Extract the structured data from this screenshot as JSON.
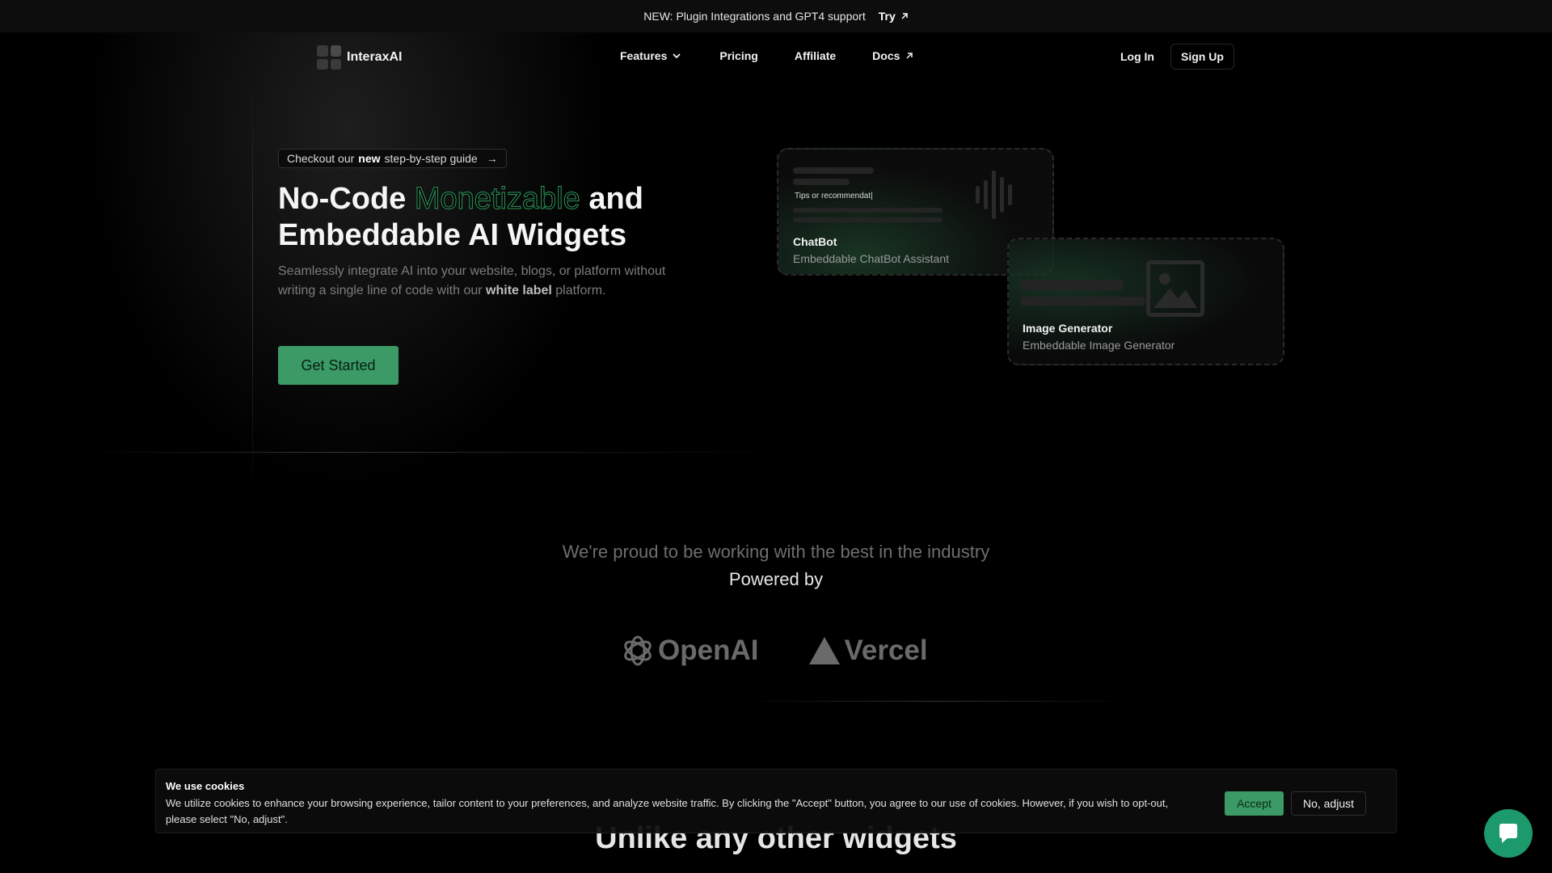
{
  "announcement": {
    "text": "NEW: Plugin Integrations and GPT4 support",
    "try_label": "Try"
  },
  "brand": {
    "name": "InteraxAI",
    "accent": "#3b9a65"
  },
  "nav": {
    "features": "Features",
    "pricing": "Pricing",
    "affiliate": "Affiliate",
    "docs": "Docs",
    "login": "Log In",
    "signup": "Sign Up"
  },
  "hero": {
    "guide_prefix": "Checkout our",
    "guide_bold": "new",
    "guide_suffix": "step-by-step guide",
    "guide_arrow": "→",
    "title_part1": "No-Code",
    "title_accent": "Monetizable",
    "title_part2": "and",
    "title_line2": "Embeddable AI Widgets",
    "sub_part1": "Seamlessly integrate AI into your website, blogs, or platform without writing a single line of code with our",
    "sub_bold": "white label",
    "sub_part2": "platform.",
    "cta": "Get Started"
  },
  "widgets": {
    "chatbot": {
      "input_text": "Tips or recommendat|",
      "title": "ChatBot",
      "subtitle": "Embeddable ChatBot Assistant"
    },
    "image_generator": {
      "title": "Image Generator",
      "subtitle": "Embeddable Image Generator"
    }
  },
  "partners_section": {
    "proud": "We're proud to be working with the best in the industry",
    "powered": "Powered by",
    "partners": [
      "OpenAI",
      "Vercel"
    ]
  },
  "next_section_title": "Unlike any other widgets",
  "cookie": {
    "title": "We use cookies",
    "text": "We utilize cookies to enhance your browsing experience, tailor content to your preferences, and analyze website traffic. By clicking the \"Accept\" button, you agree to our use of cookies. However, if you wish to opt-out, please select \"No, adjust\".",
    "accept": "Accept",
    "adjust": "No, adjust"
  },
  "icons": {
    "try_arrow": "arrow-up-right-icon",
    "features_dropdown": "chevron-down-icon",
    "docs_external": "arrow-up-right-icon",
    "chat_launcher": "chat-bubble-icon"
  }
}
